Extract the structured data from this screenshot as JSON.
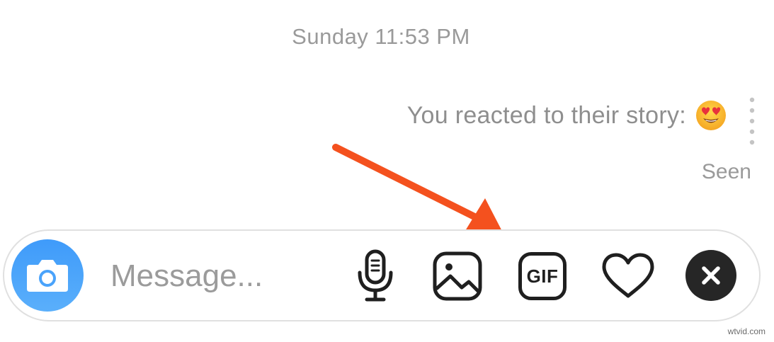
{
  "conversation": {
    "timestamp": "Sunday 11:53 PM",
    "reaction_text": "You reacted to their story:",
    "reaction_emoji": "smiling-face-with-heart-eyes",
    "seen_label": "Seen"
  },
  "annotation": {
    "arrow_color": "#f4511e",
    "points_to": "gif-button"
  },
  "composer": {
    "placeholder": "Message...",
    "value": "",
    "camera_color": "#3f9bfa",
    "buttons": [
      {
        "name": "camera",
        "icon": "camera-icon"
      },
      {
        "name": "voice",
        "icon": "microphone-icon"
      },
      {
        "name": "gallery",
        "icon": "image-icon"
      },
      {
        "name": "gif",
        "icon": "gif-icon",
        "label": "GIF"
      },
      {
        "name": "like",
        "icon": "heart-icon"
      },
      {
        "name": "close",
        "icon": "close-icon"
      }
    ]
  },
  "watermark": "wtvid.com"
}
